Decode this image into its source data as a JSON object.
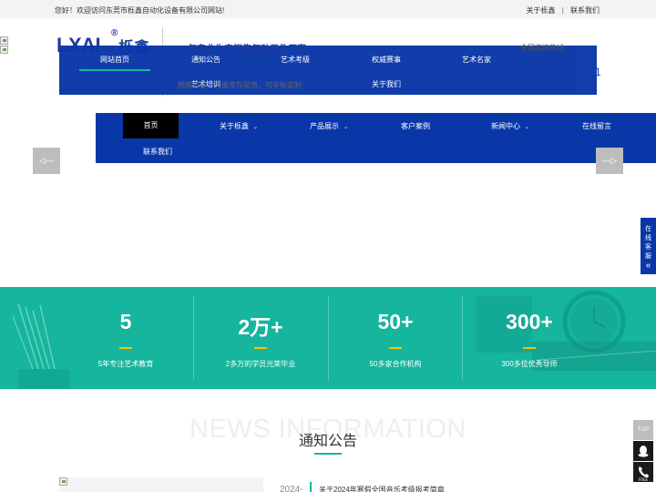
{
  "topbar": {
    "welcome": "您好！欢迎访问东莞市栎鑫自动化设备有限公司网站!",
    "links": [
      "关于栎鑫",
      "联系我们"
    ],
    "separator": "|"
  },
  "logo": {
    "brand": "LXAI",
    "registered": "®",
    "cn": "栎鑫"
  },
  "slogan": {
    "line1": "10年专业生产销售气动元件厂家",
    "line2": "规格齐全，大量库存现货，可非标定制"
  },
  "hotline": {
    "label": "全国咨询热线:",
    "number": "1"
  },
  "nav_primary": {
    "items": [
      "网站首页",
      "通知公告",
      "艺术考级",
      "权威赛事",
      "艺术名家",
      "艺术培训",
      "关于我们"
    ]
  },
  "nav_secondary": {
    "items": [
      {
        "label": "首页",
        "dropdown": false
      },
      {
        "label": "关于栎鑫",
        "dropdown": true
      },
      {
        "label": "产品展示",
        "dropdown": true
      },
      {
        "label": "客户案例",
        "dropdown": false
      },
      {
        "label": "新闻中心",
        "dropdown": true
      },
      {
        "label": "在线留言",
        "dropdown": false
      },
      {
        "label": "联系我们",
        "dropdown": false
      }
    ],
    "chevron": "⌄"
  },
  "slider": {
    "prev": "◁—",
    "next": "—▷"
  },
  "side_service": {
    "chars": [
      "在",
      "线",
      "客",
      "服"
    ],
    "arrow": "«"
  },
  "stats": [
    {
      "num": "5",
      "label": "5年专注艺术教育"
    },
    {
      "num": "2万+",
      "label": "2多万的学员光荣毕业"
    },
    {
      "num": "50+",
      "label": "50多家合作机构"
    },
    {
      "num": "300+",
      "label": "300多位优秀导师"
    }
  ],
  "news": {
    "bg_text": "NEWS INFORMATION",
    "title": "通知公告",
    "first_date": "2024-",
    "first_item": "关于2024年寒假全国音乐考级报考简章"
  },
  "tools": {
    "top": "TOP",
    "qq": "QQ",
    "free": "FREE"
  },
  "colors": {
    "brand_blue": "#0a37a8",
    "teal": "#16b59d",
    "accent_yellow": "#f5c400"
  }
}
